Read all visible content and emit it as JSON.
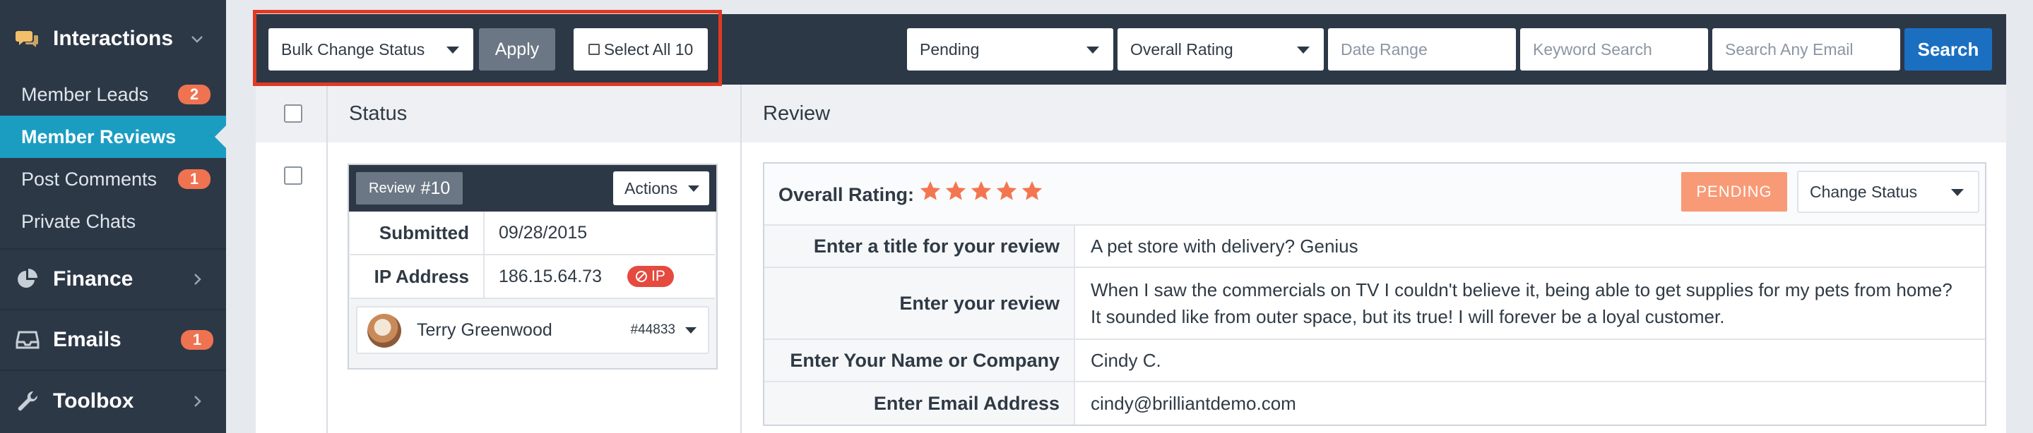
{
  "sidebar": {
    "interactions": {
      "label": "Interactions"
    },
    "items": [
      {
        "label": "Member Leads",
        "badge": "2"
      },
      {
        "label": "Member Reviews"
      },
      {
        "label": "Post Comments",
        "badge": "1"
      },
      {
        "label": "Private Chats"
      }
    ],
    "finance": {
      "label": "Finance"
    },
    "emails": {
      "label": "Emails",
      "badge": "1"
    },
    "toolbox": {
      "label": "Toolbox"
    }
  },
  "toolbar": {
    "bulk_change": "Bulk Change Status",
    "apply": "Apply",
    "select_all": "Select All 10",
    "status_filter": "Pending",
    "rating_filter": "Overall Rating",
    "date_placeholder": "Date Range",
    "keyword_placeholder": "Keyword Search",
    "email_placeholder": "Search Any Email",
    "search": "Search"
  },
  "table": {
    "columns": [
      "Status",
      "Review"
    ]
  },
  "status_card": {
    "review_word": "Review",
    "review_num": "#10",
    "actions": "Actions",
    "rows": [
      {
        "label": "Submitted",
        "value": "09/28/2015"
      },
      {
        "label": "IP Address",
        "value": "186.15.64.73",
        "badge": "IP"
      }
    ],
    "member": {
      "name": "Terry Greenwood",
      "id": "#44833"
    }
  },
  "review_card": {
    "overall_label": "Overall Rating:",
    "rating": 5,
    "star_color": "#f47650",
    "status_badge": "PENDING",
    "change_status": "Change Status",
    "fields": [
      {
        "label": "Enter a title for your review",
        "value": "A pet store with delivery? Genius"
      },
      {
        "label": "Enter your review",
        "value": "When I saw the commercials on TV I couldn't believe it, being able to get supplies for my pets from home? It sounded like from outer space, but its true! I will forever be a loyal customer."
      },
      {
        "label": "Enter Your Name or Company",
        "value": "Cindy C."
      },
      {
        "label": "Enter Email Address",
        "value": "cindy@brilliantdemo.com"
      }
    ]
  }
}
